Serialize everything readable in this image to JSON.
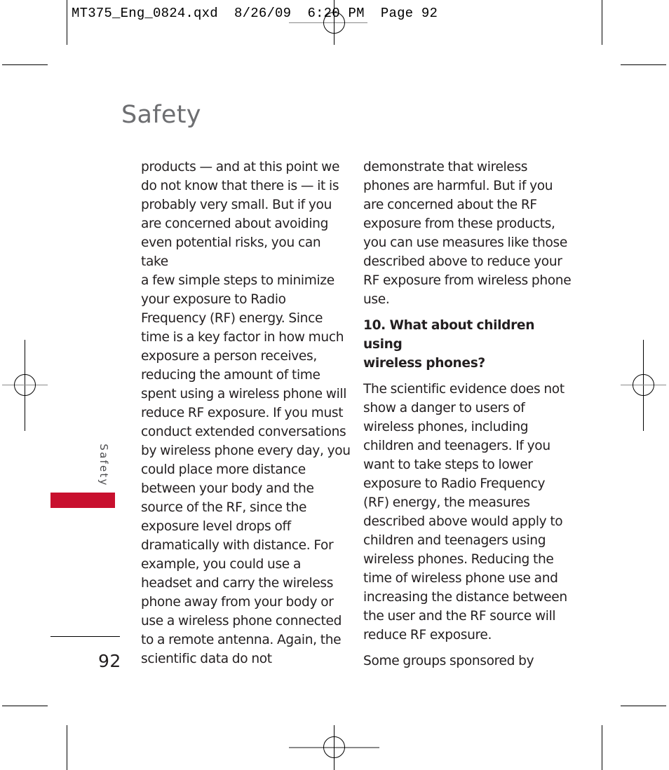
{
  "print_slug": {
    "text": "MT375_Eng_0824.qxd  8/26/09  6:20 PM  Page 92"
  },
  "header": {
    "section_title": "Safety"
  },
  "side_tab": {
    "label": "Safety",
    "accent_color": "#c8102e"
  },
  "left_column": {
    "paragraphs": [
      "products — and at this point we\ndo not know that there is — it is\nprobably very small. But if you\nare concerned about avoiding\neven potential risks, you can take\na few simple steps to minimize\nyour exposure to Radio\nFrequency (RF) energy. Since\ntime is a key factor in how much\nexposure a person receives,\nreducing the amount of time\nspent using a wireless phone will\nreduce RF exposure. If you must\nconduct extended conversations\nby wireless phone every day, you\ncould place more distance\nbetween your body and the\nsource of the RF, since the\nexposure level drops off\ndramatically with distance. For\nexample, you could use a\nheadset and carry the wireless\nphone away from your body or\nuse a wireless phone connected\nto a remote antenna. Again, the\nscientific data do not"
    ]
  },
  "right_column": {
    "paragraphs": [
      "demonstrate that wireless\nphones are harmful. But if you\nare concerned about the RF\nexposure from these products,\nyou can use measures like those\ndescribed above to reduce your\nRF exposure from wireless phone\nuse."
    ],
    "heading": "10. What about children using\nwireless phones?",
    "body_paragraphs": [
      "The scientific evidence does not\nshow a danger to users of\nwireless phones, including\nchildren and teenagers. If you\nwant to take steps to lower\nexposure to Radio Frequency\n(RF) energy, the measures\ndescribed above would apply to\nchildren and teenagers using\nwireless phones. Reducing the\ntime of wireless phone use and\nincreasing the distance between\nthe user and the RF source will\nreduce RF exposure.",
      "Some groups sponsored by"
    ]
  },
  "footer": {
    "page_number": "92"
  }
}
